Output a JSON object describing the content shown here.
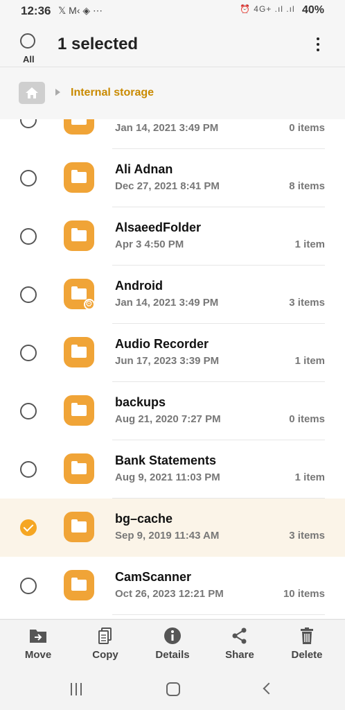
{
  "status_bar": {
    "time": "12:36",
    "notif_text": "𝕏 M‹ ◈ ⋯",
    "signal_text": "⏰ 4G+ .ıl .ıl",
    "battery": "40%"
  },
  "header": {
    "title": "1 selected",
    "all_label": "All"
  },
  "breadcrumb": {
    "location": "Internal storage"
  },
  "files": [
    {
      "name": "",
      "date": "Jan 14, 2021 3:49 PM",
      "count": "0 items",
      "selected": false,
      "gear": false
    },
    {
      "name": "Ali Adnan",
      "date": "Dec 27, 2021 8:41 PM",
      "count": "8 items",
      "selected": false,
      "gear": false
    },
    {
      "name": "AlsaeedFolder",
      "date": "Apr 3 4:50 PM",
      "count": "1 item",
      "selected": false,
      "gear": false
    },
    {
      "name": "Android",
      "date": "Jan 14, 2021 3:49 PM",
      "count": "3 items",
      "selected": false,
      "gear": true
    },
    {
      "name": "Audio Recorder",
      "date": "Jun 17, 2023 3:39 PM",
      "count": "1 item",
      "selected": false,
      "gear": false
    },
    {
      "name": "backups",
      "date": "Aug 21, 2020 7:27 PM",
      "count": "0 items",
      "selected": false,
      "gear": false
    },
    {
      "name": "Bank Statements",
      "date": "Aug 9, 2021 11:03 PM",
      "count": "1 item",
      "selected": false,
      "gear": false
    },
    {
      "name": "bg–cache",
      "date": "Sep 9, 2019 11:43 AM",
      "count": "3 items",
      "selected": true,
      "gear": false
    },
    {
      "name": "CamScanner",
      "date": "Oct 26, 2023 12:21 PM",
      "count": "10 items",
      "selected": false,
      "gear": false
    }
  ],
  "actions": [
    {
      "label": "Move",
      "icon": "move-icon"
    },
    {
      "label": "Copy",
      "icon": "copy-icon"
    },
    {
      "label": "Details",
      "icon": "info-icon"
    },
    {
      "label": "Share",
      "icon": "share-icon"
    },
    {
      "label": "Delete",
      "icon": "trash-icon"
    }
  ],
  "colors": {
    "accent": "#f0a437",
    "breadcrumb": "#c98a00",
    "selected_row": "#fbf4e8"
  }
}
